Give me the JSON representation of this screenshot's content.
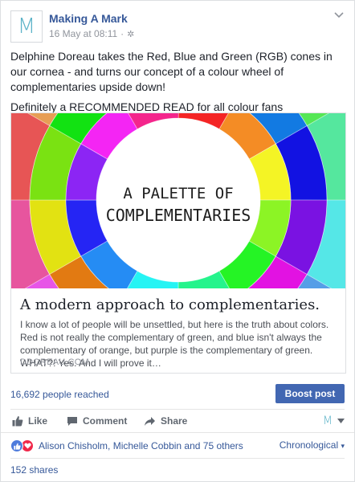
{
  "post": {
    "page_name": "Making A Mark",
    "avatar_letter": "M",
    "timestamp": "16 May at 08:11",
    "separator": "·",
    "message_line1": "Delphine Doreau takes the Red, Blue and Green (RGB) cones in our cornea - and turns our concept of a colour wheel of complementaries upside down!",
    "message_line2": "Definitely a RECOMMENDED READ for all colour fans"
  },
  "preview": {
    "image_caption_line1": "A PALETTE OF",
    "image_caption_line2": "COMPLEMENTARIES",
    "title": "A modern approach to complementaries.",
    "description": "I know a lot of people will be unsettled, but here is the truth about colors. Red is not really the complementary of green, and blue isn't always the complementary of orange, but purple is the complementary of green. WHAT?! Yes. And I will prove it…",
    "domain": "DDOREAU.COM"
  },
  "stats": {
    "reach": "16,692 people reached",
    "boost_label": "Boost post"
  },
  "actions": {
    "like": "Like",
    "comment": "Comment",
    "share": "Share",
    "selector_letter": "M"
  },
  "reactions": {
    "names": "Alison Chisholm, Michelle Cobbin and 75 others",
    "sort_label": "Chronological",
    "shares": "152 shares"
  },
  "colors": {
    "link": "#365899",
    "boost_bg": "#4267b2",
    "like_reaction": "#4e7bdc",
    "love_reaction": "#f0284a",
    "brand_teal": "#5cb3c8"
  },
  "icons": [
    "gear-icon",
    "chevron-down-icon",
    "like-icon",
    "comment-icon",
    "share-icon",
    "caret-down-icon",
    "like-reaction-icon",
    "love-reaction-icon"
  ]
}
